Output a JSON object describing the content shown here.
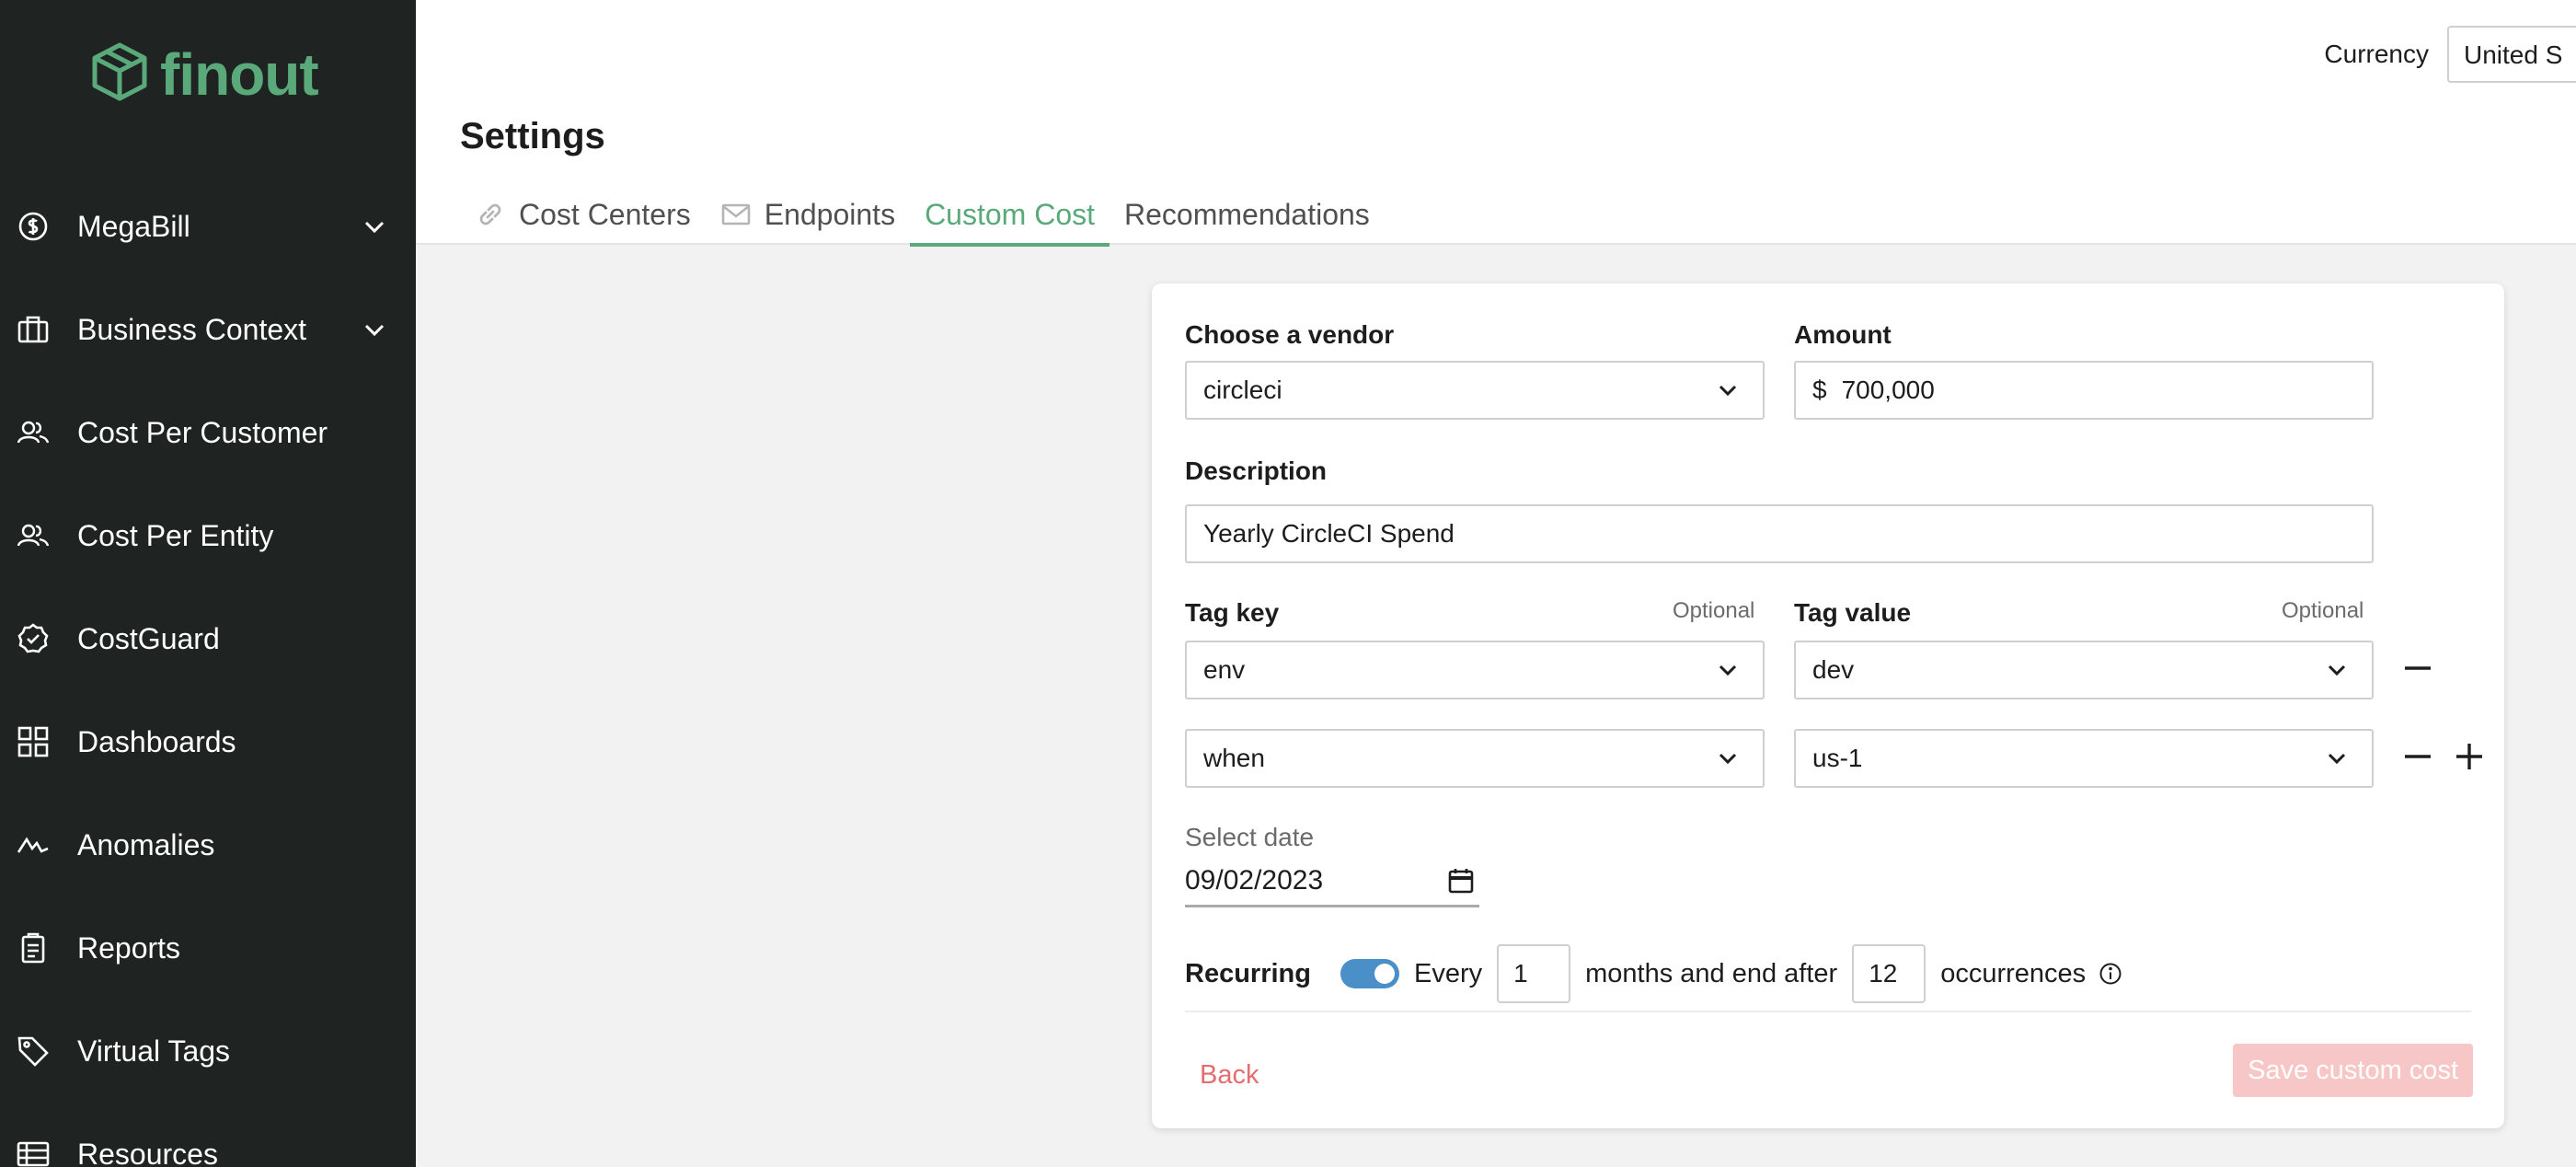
{
  "brand": {
    "name": "finout",
    "color": "#59a97a"
  },
  "sidebar": {
    "items": [
      {
        "label": "MegaBill",
        "icon": "dollar-circle-icon",
        "expandable": true
      },
      {
        "label": "Business Context",
        "icon": "briefcase-icon",
        "expandable": true
      },
      {
        "label": "Cost Per Customer",
        "icon": "users-icon",
        "expandable": false
      },
      {
        "label": "Cost Per Entity",
        "icon": "users-icon",
        "expandable": false
      },
      {
        "label": "CostGuard",
        "icon": "shield-check-icon",
        "expandable": false
      },
      {
        "label": "Dashboards",
        "icon": "grid-icon",
        "expandable": false
      },
      {
        "label": "Anomalies",
        "icon": "anomaly-line-icon",
        "expandable": false
      },
      {
        "label": "Reports",
        "icon": "clipboard-icon",
        "expandable": false
      },
      {
        "label": "Virtual Tags",
        "icon": "tag-icon",
        "expandable": false
      },
      {
        "label": "Resources",
        "icon": "table-icon",
        "expandable": false
      }
    ]
  },
  "header": {
    "currency_label": "Currency",
    "currency_value": "United S",
    "title": "Settings",
    "tabs": [
      {
        "label": "Cost Centers",
        "icon": "link-icon",
        "active": false
      },
      {
        "label": "Endpoints",
        "icon": "mail-icon",
        "active": false
      },
      {
        "label": "Custom Cost",
        "icon": "",
        "active": true
      },
      {
        "label": "Recommendations",
        "icon": "",
        "active": false
      }
    ]
  },
  "form": {
    "vendor_label": "Choose a vendor",
    "vendor_value": "circleci",
    "amount_label": "Amount",
    "amount_prefix": "$",
    "amount_value": "700,000",
    "description_label": "Description",
    "description_value": "Yearly CircleCI Spend",
    "tag_key_label": "Tag key",
    "tag_value_label": "Tag value",
    "optional_text": "Optional",
    "tag_rows": [
      {
        "key": "env",
        "value": "dev"
      },
      {
        "key": "when",
        "value": "us-1"
      }
    ],
    "date_label": "Select date",
    "date_value": "09/02/2023",
    "recurring_label": "Recurring",
    "recurring_on": true,
    "every_text": "Every",
    "every_value": "1",
    "months_text": "months and end after",
    "occurrences_value": "12",
    "occurrences_text": "occurrences",
    "back_label": "Back",
    "save_label": "Save custom cost"
  },
  "colors": {
    "sidebar_bg": "#1f2322",
    "accent_green": "#59a97a",
    "toggle_blue": "#4a8fc7",
    "back_red": "#e46d6d",
    "save_disabled": "#f7c7c7"
  }
}
